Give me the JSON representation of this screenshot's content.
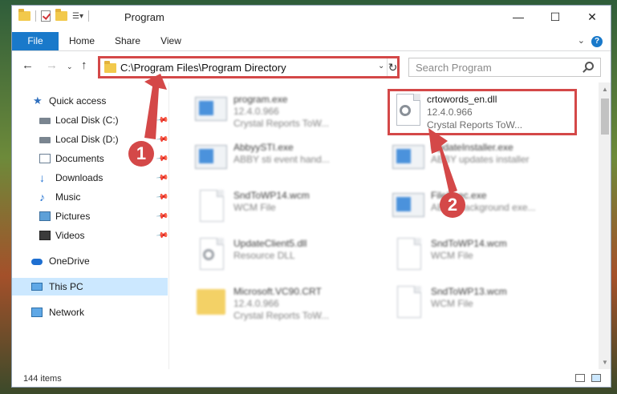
{
  "window": {
    "title": "Program",
    "controls": {
      "minimize": "—",
      "maximize": "☐",
      "close": "✕"
    }
  },
  "ribbon": {
    "tabs": [
      "File",
      "Home",
      "Share",
      "View"
    ]
  },
  "address": {
    "path": "C:\\Program Files\\Program Directory"
  },
  "search": {
    "placeholder": "Search Program"
  },
  "sidebar": {
    "items": [
      {
        "label": "Quick access",
        "icon": "star-icon",
        "pinned": false
      },
      {
        "label": "Local Disk (C:)",
        "icon": "disk-icon",
        "pinned": true
      },
      {
        "label": "Local Disk (D:)",
        "icon": "disk-icon",
        "pinned": true
      },
      {
        "label": "Documents",
        "icon": "documents-icon",
        "pinned": true
      },
      {
        "label": "Downloads",
        "icon": "download-icon",
        "pinned": true
      },
      {
        "label": "Music",
        "icon": "music-icon",
        "pinned": true
      },
      {
        "label": "Pictures",
        "icon": "pictures-icon",
        "pinned": true
      },
      {
        "label": "Videos",
        "icon": "videos-icon",
        "pinned": true
      },
      {
        "label": "OneDrive",
        "icon": "cloud-icon",
        "pinned": false
      },
      {
        "label": "This PC",
        "icon": "pc-icon",
        "pinned": false,
        "selected": true
      },
      {
        "label": "Network",
        "icon": "network-icon",
        "pinned": false
      }
    ]
  },
  "files": [
    {
      "name": "program.exe",
      "line2": "12.4.0.966",
      "line3": "Crystal Reports ToW...",
      "icon": "exe-icon"
    },
    {
      "name": "crtowords_en.dll",
      "line2": "12.4.0.966",
      "line3": "Crystal Reports ToW...",
      "icon": "dll-gear-icon",
      "highlighted": true
    },
    {
      "name": "AbbyySTI.exe",
      "line2": "ABBY sti event hand...",
      "line3": "",
      "icon": "app-icon"
    },
    {
      "name": "UpdateInstaller.exe",
      "line2": "ABBY updates installer",
      "line3": "",
      "icon": "app-icon"
    },
    {
      "name": "SndToWP14.wcm",
      "line2": "WCM File",
      "line3": "",
      "icon": "file-icon"
    },
    {
      "name": "FileSpec.exe",
      "line2": "ABBY background exe...",
      "line3": "",
      "icon": "app-icon"
    },
    {
      "name": "UpdateClient5.dll",
      "line2": "Resource DLL",
      "line3": "",
      "icon": "dll-icon"
    },
    {
      "name": "SndToWP14.wcm",
      "line2": "WCM File",
      "line3": "",
      "icon": "file-icon"
    },
    {
      "name": "Microsoft.VC90.CRT",
      "line2": "12.4.0.966",
      "line3": "Crystal Reports ToW...",
      "icon": "folder-icon"
    },
    {
      "name": "SndToWP13.wcm",
      "line2": "WCM File",
      "line3": "",
      "icon": "file-icon"
    }
  ],
  "status": {
    "count": "144 items"
  },
  "annotations": {
    "step1": "1",
    "step2": "2"
  },
  "colors": {
    "accent": "#1979ca",
    "highlight": "#d44848",
    "selected": "#cce8ff"
  }
}
